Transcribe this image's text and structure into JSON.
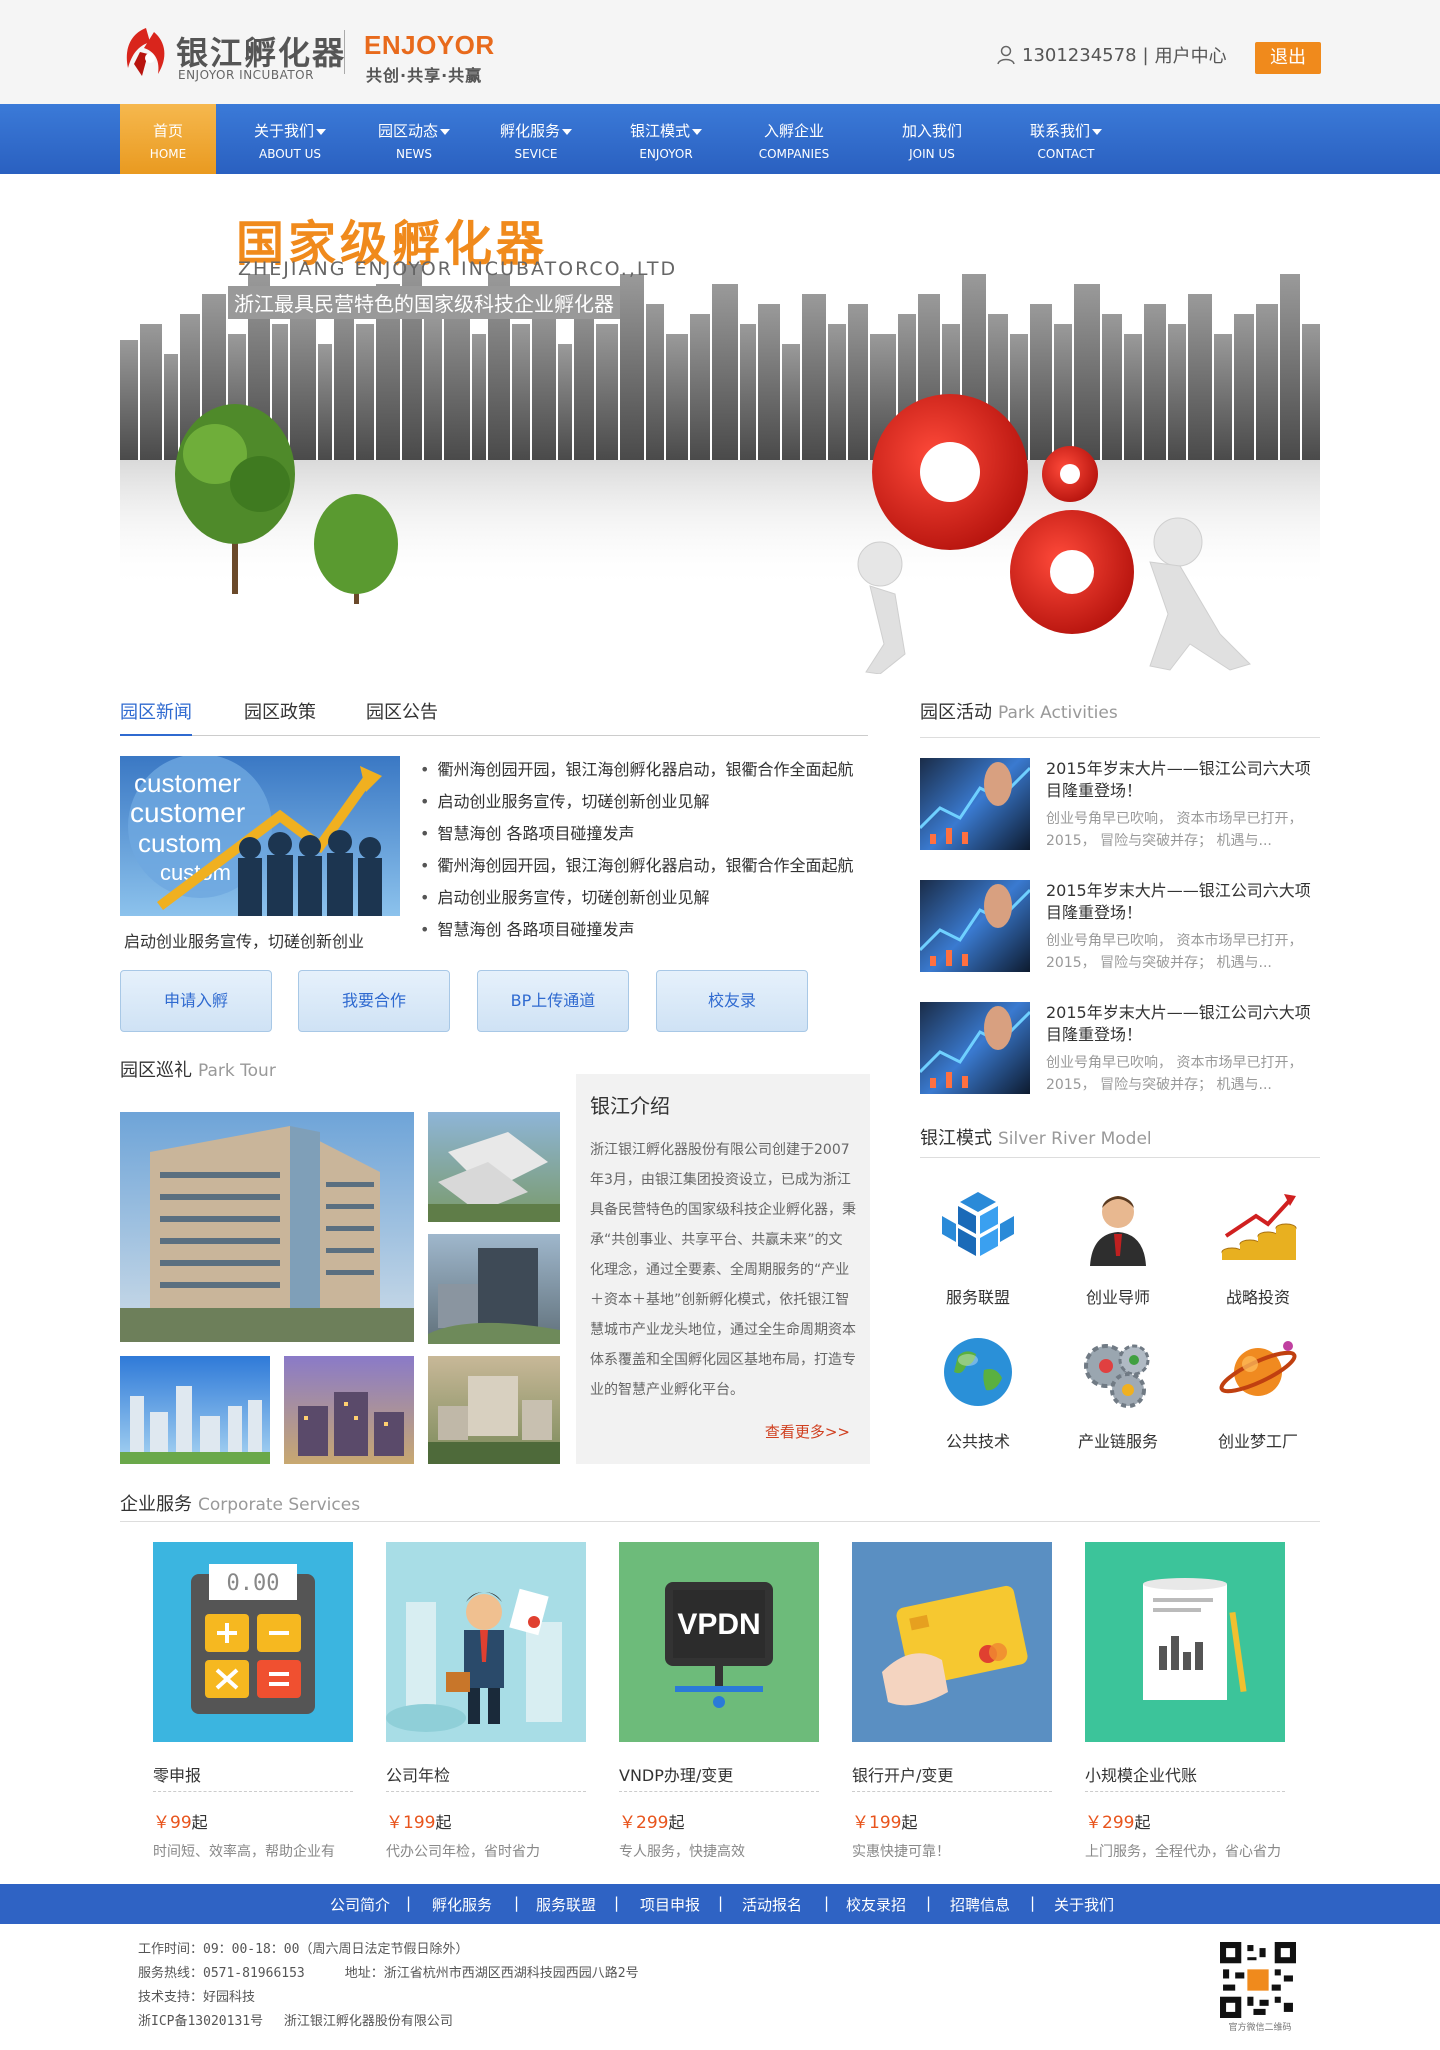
{
  "header": {
    "logo_cn": "银江孵化器",
    "logo_en": "ENJOYOR INCUBATOR",
    "brand_en": "ENJOYOR",
    "brand_slogan": "共创·共享·共赢",
    "phone": "1301234578",
    "separator": "|",
    "user_center": "用户中心",
    "logout": "退出"
  },
  "nav": [
    {
      "cn": "首页",
      "en": "HOME",
      "active": true
    },
    {
      "cn": "关于我们",
      "en": "ABOUT US",
      "caret": true
    },
    {
      "cn": "园区动态",
      "en": "NEWS",
      "caret": true
    },
    {
      "cn": "孵化服务",
      "en": "SEVICE",
      "caret": true
    },
    {
      "cn": "银江模式",
      "en": "ENJOYOR",
      "caret": true
    },
    {
      "cn": "入孵企业",
      "en": "COMPANIES"
    },
    {
      "cn": "加入我们",
      "en": "JOIN US"
    },
    {
      "cn": "联系我们",
      "en": "CONTACT",
      "caret": true
    }
  ],
  "banner": {
    "title": "国家级孵化器",
    "en": "ZHEJIANG ENJOYOR INCUBATORCO.,LTD",
    "subtitle": "浙江最具民营特色的国家级科技企业孵化器"
  },
  "news": {
    "tabs": [
      "园区新闻",
      "园区政策",
      "园区公告"
    ],
    "image_caption": "启动创业服务宣传，切磋创新创业",
    "items": [
      "衢州海创园开园，银江海创孵化器启动，银衢合作全面起航",
      "启动创业服务宣传，切磋创新创业见解",
      "智慧海创 各路项目碰撞发声",
      "衢州海创园开园，银江海创孵化器启动，银衢合作全面起航",
      "启动创业服务宣传，切磋创新创业见解",
      "智慧海创 各路项目碰撞发声"
    ],
    "image_words": [
      "customer",
      "customer",
      "custom",
      "custom"
    ]
  },
  "quick_buttons": [
    "申请入孵",
    "我要合作",
    "BP上传通道",
    "校友录"
  ],
  "park_tour": {
    "cn": "园区巡礼",
    "en": "Park Tour"
  },
  "intro": {
    "title": "银江介绍",
    "body": "浙江银江孵化器股份有限公司创建于2007年3月，由银江集团投资设立，已成为浙江具备民营特色的国家级科技企业孵化器，秉承“共创事业、共享平台、共赢未来”的文化理念，通过全要素、全周期服务的“产业＋资本＋基地”创新孵化模式，依托银江智慧城市产业龙头地位，通过全生命周期资本体系覆盖和全国孵化园区基地布局，打造专业的智慧产业孵化平台。",
    "more": "查看更多>>"
  },
  "activities": {
    "cn": "园区活动",
    "en": "Park Activities",
    "items": [
      {
        "title": "2015年岁末大片——银江公司六大项目隆重登场！",
        "desc": "创业号角早已吹响， 资本市场早已打开，2015， 冒险与突破并存； 机遇与..."
      },
      {
        "title": "2015年岁末大片——银江公司六大项目隆重登场！",
        "desc": "创业号角早已吹响， 资本市场早已打开，2015， 冒险与突破并存； 机遇与..."
      },
      {
        "title": "2015年岁末大片——银江公司六大项目隆重登场！",
        "desc": "创业号角早已吹响， 资本市场早已打开，2015， 冒险与突破并存； 机遇与..."
      }
    ]
  },
  "model": {
    "cn": "银江模式",
    "en": "Silver River Model",
    "items": [
      {
        "label": "服务联盟",
        "icon": "cube-network-icon"
      },
      {
        "label": "创业导师",
        "icon": "mentor-icon"
      },
      {
        "label": "战略投资",
        "icon": "coin-growth-icon"
      },
      {
        "label": "公共技术",
        "icon": "globe-icon"
      },
      {
        "label": "产业链服务",
        "icon": "gears-icon"
      },
      {
        "label": "创业梦工厂",
        "icon": "planet-icon"
      }
    ]
  },
  "services": {
    "cn": "企业服务",
    "en": "Corporate Services",
    "items": [
      {
        "name": "零申报",
        "price": "￥99",
        "unit": "起",
        "desc": "时间短、效率高，帮助企业有",
        "icon": "calculator-icon",
        "color": "#3bb5e0"
      },
      {
        "name": "公司年检",
        "price": "￥199",
        "unit": "起",
        "desc": "代办公司年检，省时省力",
        "icon": "businessman-icon",
        "color": "#a8dde6"
      },
      {
        "name": "VNDP办理/变更",
        "price": "￥299",
        "unit": "起",
        "desc": "专人服务，快捷高效",
        "icon": "vpdn-icon",
        "color": "#6dbb7a",
        "tile_text": "VPDN"
      },
      {
        "name": "银行开户/变更",
        "price": "￥199",
        "unit": "起",
        "desc": "实惠快捷可靠！",
        "icon": "bank-card-icon",
        "color": "#5a8fc2"
      },
      {
        "name": "小规模企业代账",
        "price": "￥299",
        "unit": "起",
        "desc": "上门服务，全程代办，省心省力",
        "icon": "ledger-icon",
        "color": "#3cc49a"
      }
    ],
    "calc_display": "0.00"
  },
  "footer": {
    "nav": [
      "公司简介",
      "孵化服务",
      "服务联盟",
      "项目申报",
      "活动报名",
      "校友录招",
      "招聘信息",
      "关于我们"
    ],
    "sep": "|",
    "hours": "工作时间：09：00-18：00（周六周日法定节假日除外）",
    "hotline": "服务热线：0571-81966153",
    "address": "地址：浙江省杭州市西湖区西湖科技园西园八路2号",
    "support": "技术支持：好园科技",
    "icp": "浙ICP备13020131号　 浙江银江孵化器股份有限公司",
    "qr_caption": "官方微信二维码"
  },
  "colors": {
    "brand_orange": "#f08a1c",
    "nav_blue": "#2f63c4",
    "active_tab": "#2f6ad0",
    "price_red": "#e8541c"
  }
}
